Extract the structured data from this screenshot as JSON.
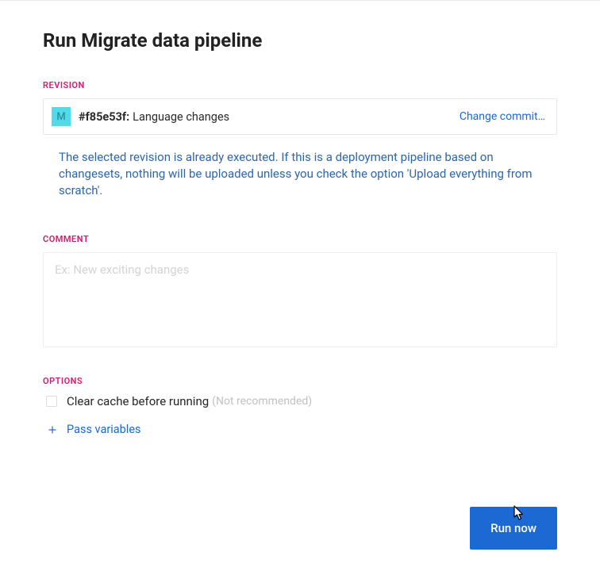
{
  "page": {
    "title": "Run Migrate data pipeline"
  },
  "revision": {
    "section_label": "REVISION",
    "avatar_initial": "M",
    "hash": "#f85e53f:",
    "message": "Language changes",
    "change_commit_label": "Change commit…",
    "info_text": "The selected revision is already executed. If this is a deployment pipeline based on changesets, nothing will be uploaded unless you check the option 'Upload everything from scratch'."
  },
  "comment": {
    "section_label": "COMMENT",
    "placeholder": "Ex: New exciting changes",
    "value": ""
  },
  "options": {
    "section_label": "OPTIONS",
    "clear_cache": {
      "label": "Clear cache before running",
      "hint": "(Not recommended)",
      "checked": false
    },
    "pass_variables_label": "Pass variables"
  },
  "actions": {
    "run_now_label": "Run now"
  }
}
